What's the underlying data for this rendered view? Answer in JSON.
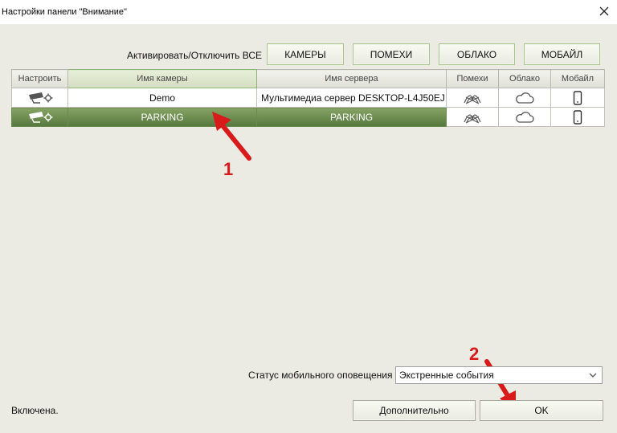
{
  "window": {
    "title": "Настройки панели \"Внимание\"",
    "close_icon": "close-icon"
  },
  "toolbar": {
    "all_label": "Активировать/Отключить ВСЕ",
    "buttons": [
      {
        "label": "КАМЕРЫ"
      },
      {
        "label": "ПОМЕХИ"
      },
      {
        "label": "ОБЛАКО"
      },
      {
        "label": "МОБАЙЛ"
      }
    ]
  },
  "grid": {
    "columns": [
      "Настроить",
      "Имя камеры",
      "Имя сервера",
      "Помехи",
      "Облако",
      "Мобайл"
    ],
    "rows": [
      {
        "camera_name": "Demo",
        "server_name": "Мультимедиа сервер DESKTOP-L4J50EJ",
        "selected": false,
        "icons": [
          "camera-settings-icon",
          "interference-icon",
          "cloud-icon",
          "mobile-icon"
        ]
      },
      {
        "camera_name": "PARKING",
        "server_name": "PARKING",
        "selected": true,
        "icons": [
          "camera-settings-icon",
          "interference-icon",
          "cloud-icon",
          "mobile-icon"
        ]
      }
    ]
  },
  "annotations": [
    {
      "label": "1",
      "color": "#d91a1a"
    },
    {
      "label": "2",
      "color": "#d91a1a"
    }
  ],
  "mobile_notify": {
    "label": "Статус мобильного оповещения",
    "selected_value": "Экстренные события"
  },
  "footer": {
    "status_text": "Включена.",
    "more_button": "Дополнительно",
    "ok_button": "OK"
  },
  "colors": {
    "accent_green": "#56783f",
    "button_border_green": "#a9c58d",
    "background": "#ebebe4",
    "annotation_red": "#d91a1a"
  }
}
